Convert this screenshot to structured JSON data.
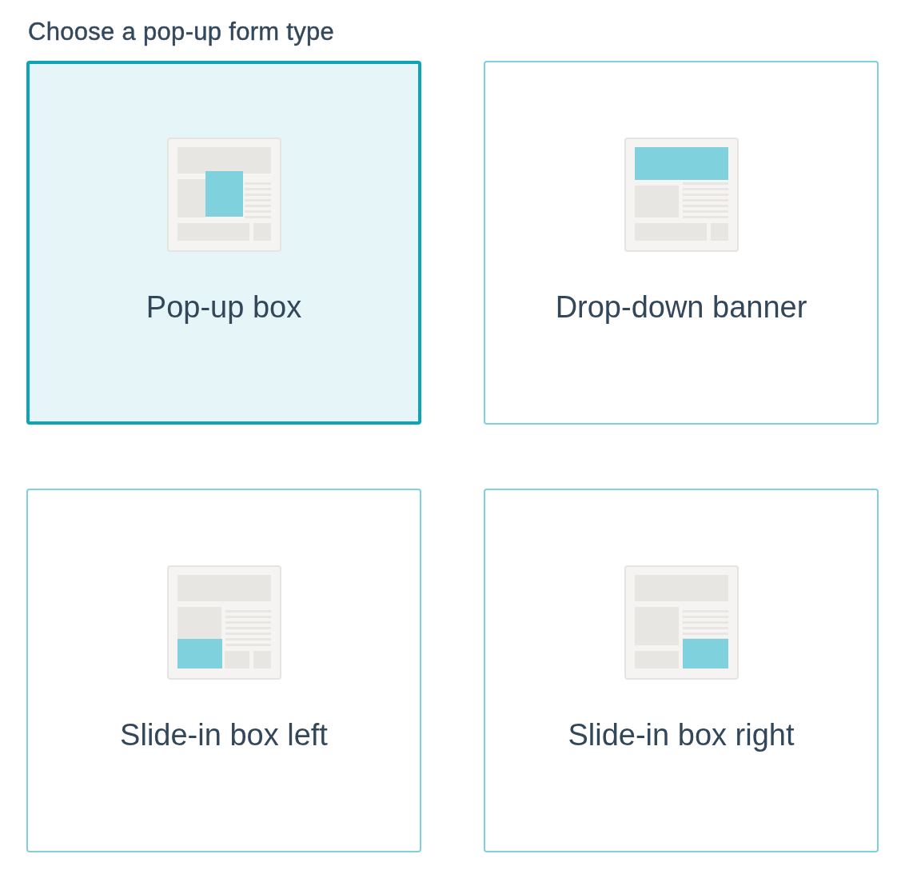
{
  "heading": "Choose a pop-up form type",
  "form_types": [
    {
      "label": "Pop-up box",
      "kind": "popup",
      "selected": true
    },
    {
      "label": "Drop-down banner",
      "kind": "banner",
      "selected": false
    },
    {
      "label": "Slide-in box left",
      "kind": "slide-left",
      "selected": false
    },
    {
      "label": "Slide-in box right",
      "kind": "slide-right",
      "selected": false
    }
  ]
}
